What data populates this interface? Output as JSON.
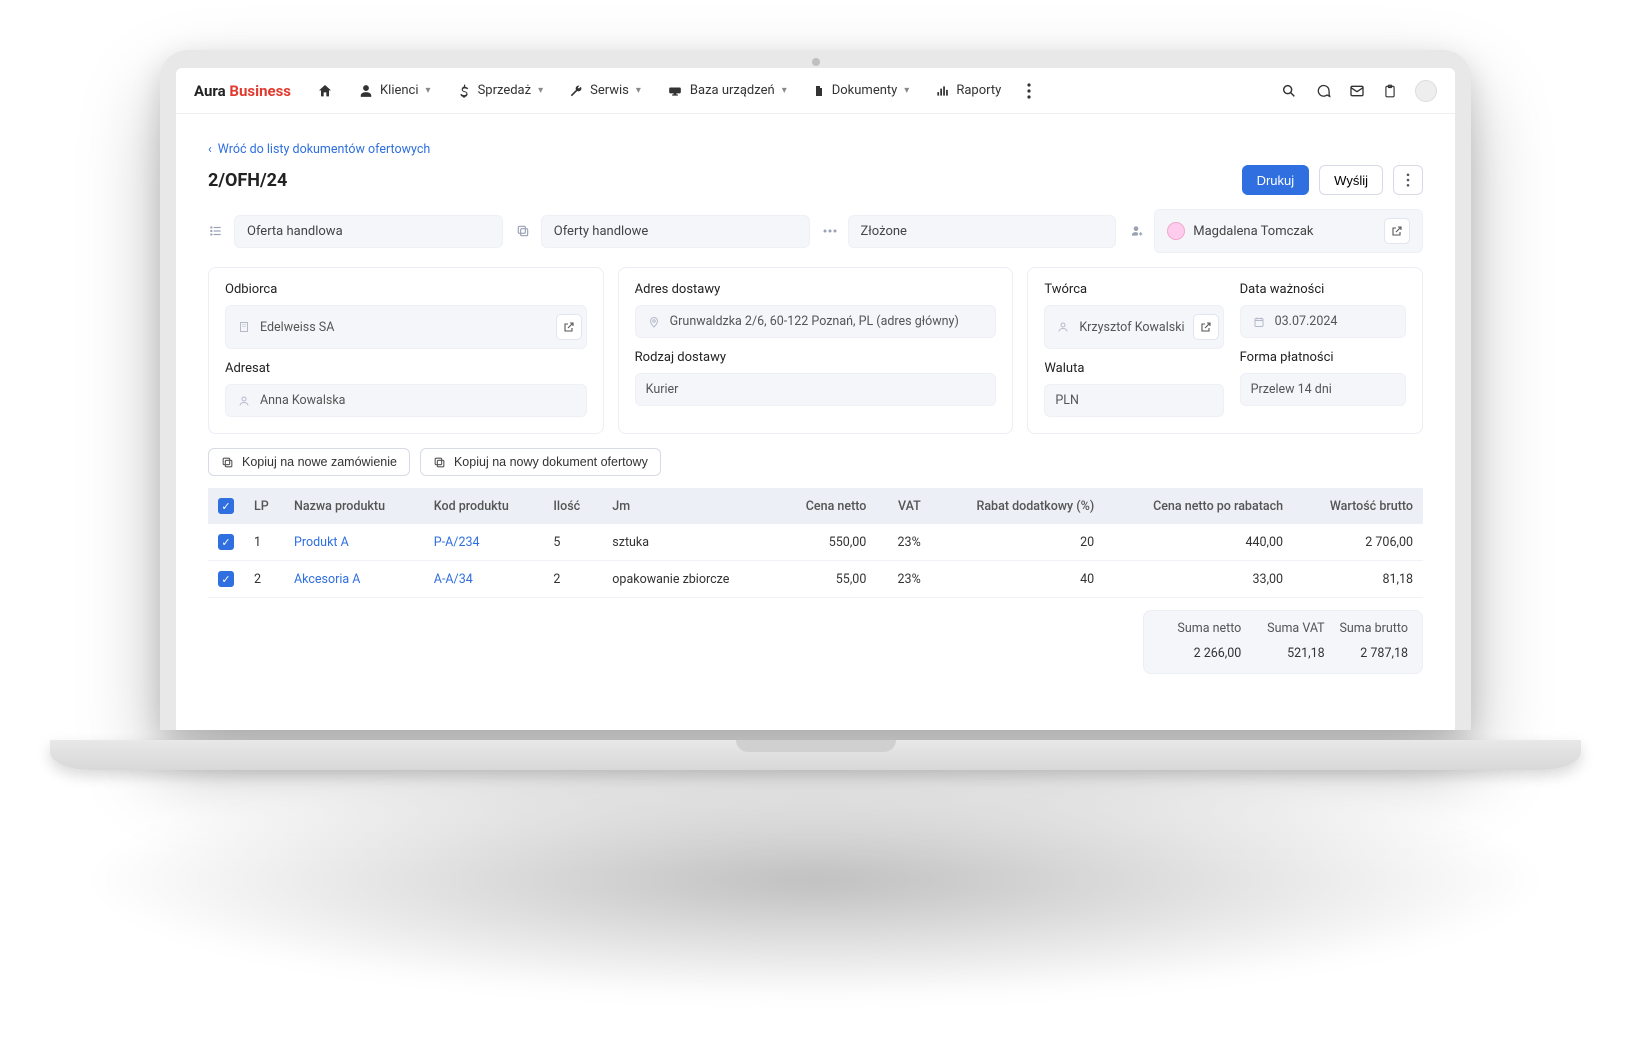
{
  "brand": {
    "a": "Aura",
    "b": "Business"
  },
  "nav": {
    "klienci": "Klienci",
    "sprzedaz": "Sprzedaż",
    "serwis": "Serwis",
    "baza": "Baza urządzeń",
    "dokumenty": "Dokumenty",
    "raporty": "Raporty"
  },
  "back_label": "Wróć do listy dokumentów ofertowych",
  "doc_title": "2/OFH/24",
  "actions": {
    "print": "Drukuj",
    "send": "Wyślij"
  },
  "meta": {
    "type": "Oferta handlowa",
    "group": "Oferty handlowe",
    "status": "Złożone",
    "owner": "Magdalena Tomczak"
  },
  "panel_recipient": {
    "label_company": "Odbiorca",
    "company": "Edelweiss SA",
    "label_person": "Adresat",
    "person": "Anna Kowalska"
  },
  "panel_delivery": {
    "label_addr": "Adres dostawy",
    "addr": "Grunwaldzka 2/6, 60-122 Poznań, PL (adres główny)",
    "label_method": "Rodzaj dostawy",
    "method": "Kurier"
  },
  "panel_meta": {
    "label_creator": "Twórca",
    "creator": "Krzysztof Kowalski",
    "label_validity": "Data ważności",
    "validity": "03.07.2024",
    "label_currency": "Waluta",
    "currency": "PLN",
    "label_payment": "Forma płatności",
    "payment": "Przelew 14 dni"
  },
  "copy": {
    "order": "Kopiuj na nowe zamówienie",
    "offer": "Kopiuj na nowy dokument ofertowy"
  },
  "table": {
    "headers": {
      "lp": "LP",
      "name": "Nazwa produktu",
      "code": "Kod produktu",
      "qty": "Ilość",
      "unit": "Jm",
      "net": "Cena netto",
      "vat": "VAT",
      "discount": "Rabat dodatkowy (%)",
      "net_after": "Cena netto po rabatach",
      "gross": "Wartość brutto"
    },
    "rows": [
      {
        "lp": "1",
        "name": "Produkt A",
        "code": "P-A/234",
        "qty": "5",
        "unit": "sztuka",
        "net": "550,00",
        "vat": "23%",
        "discount": "20",
        "net_after": "440,00",
        "gross": "2 706,00"
      },
      {
        "lp": "2",
        "name": "Akcesoria A",
        "code": "A-A/34",
        "qty": "2",
        "unit": "opakowanie zbiorcze",
        "net": "55,00",
        "vat": "23%",
        "discount": "40",
        "net_after": "33,00",
        "gross": "81,18"
      }
    ]
  },
  "totals": {
    "label_net": "Suma netto",
    "label_vat": "Suma VAT",
    "label_gross": "Suma brutto",
    "net": "2 266,00",
    "vat": "521,18",
    "gross": "2 787,18"
  }
}
